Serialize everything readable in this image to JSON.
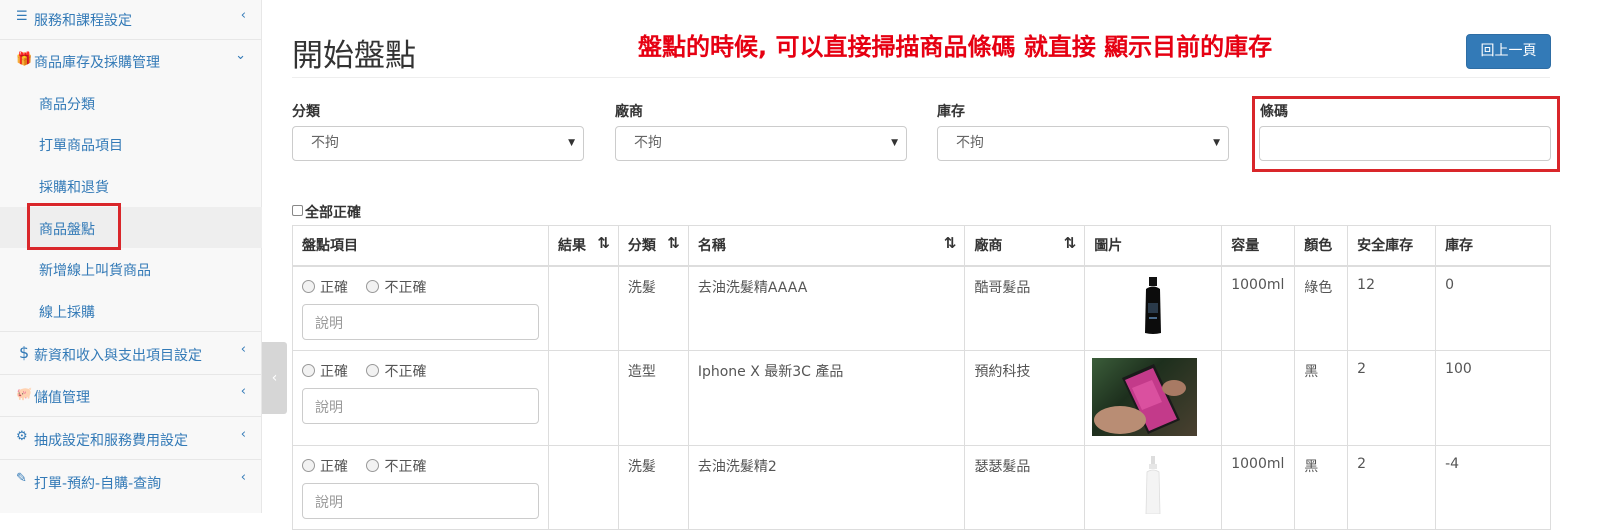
{
  "sidebar": {
    "items": [
      {
        "label": "服務和課程設定",
        "icon": "list-icon"
      },
      {
        "label": "商品庫存及採購管理",
        "icon": "gift-icon"
      },
      {
        "label": "薪資和收入與支出項目設定",
        "icon": "dollar-icon"
      },
      {
        "label": "儲值管理",
        "icon": "piggy-bank-icon"
      },
      {
        "label": "抽成設定和服務費用設定",
        "icon": "gear-icon"
      },
      {
        "label": "打單-預約-自購-查詢",
        "icon": "edit-icon"
      }
    ],
    "subitems": [
      "商品分類",
      "打單商品項目",
      "採購和退貨",
      "商品盤點",
      "新增線上叫貨商品",
      "線上採購"
    ],
    "active_subitem": "商品盤點"
  },
  "page": {
    "title": "開始盤點",
    "annotation": "盤點的時候, 可以直接掃描商品條碼 就直接 顯示目前的庫存",
    "back_button": "回上一頁"
  },
  "filters": {
    "category_label": "分類",
    "category_value": "不拘",
    "vendor_label": "廠商",
    "vendor_value": "不拘",
    "stock_label": "庫存",
    "stock_value": "不拘",
    "barcode_label": "條碼",
    "barcode_value": ""
  },
  "all_correct_label": "全部正確",
  "table": {
    "headers": [
      "盤點項目",
      "結果",
      "分類",
      "名稱",
      "廠商",
      "圖片",
      "容量",
      "顏色",
      "安全庫存",
      "庫存"
    ],
    "correct_label": "正確",
    "incorrect_label": "不正確",
    "desc_placeholder": "說明",
    "rows": [
      {
        "category": "洗髮",
        "name": "去油洗髮精AAAA",
        "vendor": "酷哥髮品",
        "image": "black-shampoo-bottle",
        "volume": "1000ml",
        "color": "綠色",
        "safety_stock": "12",
        "stock": "0"
      },
      {
        "category": "造型",
        "name": "Iphone X 最新3C 產品",
        "vendor": "預約科技",
        "image": "smartphone-photo",
        "volume": "",
        "color": "黑",
        "safety_stock": "2",
        "stock": "100"
      },
      {
        "category": "洗髮",
        "name": "去油洗髮精2",
        "vendor": "瑟瑟髮品",
        "image": "white-pump-bottle",
        "volume": "1000ml",
        "color": "黑",
        "safety_stock": "2",
        "stock": "-4"
      }
    ]
  },
  "colors": {
    "accent": "#337ab7",
    "annotation": "#e60012",
    "highlight_box": "#d9262a"
  }
}
